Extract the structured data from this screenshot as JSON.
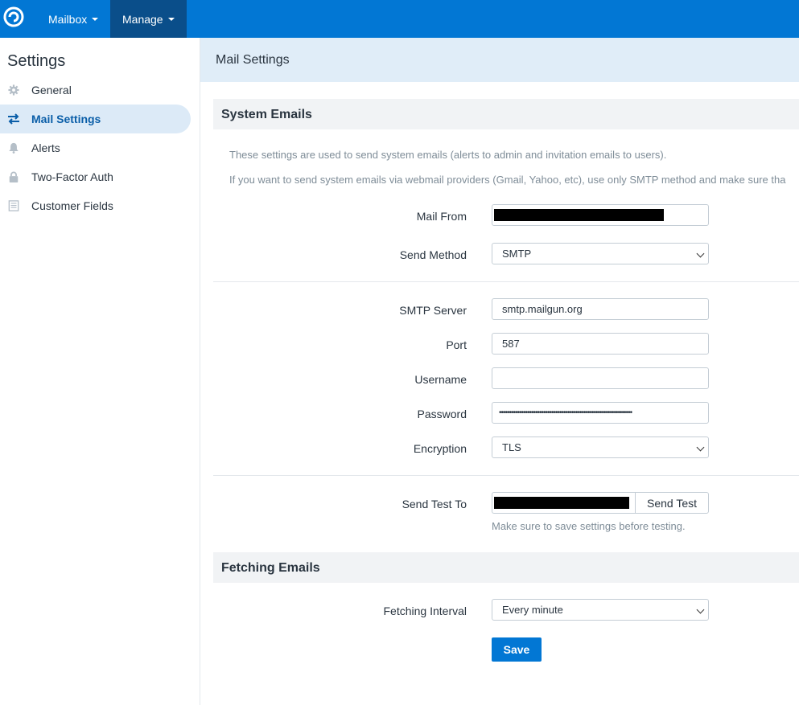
{
  "topbar": {
    "logo_icon": "freescout-logo-icon",
    "nav": [
      {
        "label": "Mailbox"
      },
      {
        "label": "Manage"
      }
    ]
  },
  "sidebar": {
    "title": "Settings",
    "items": [
      {
        "label": "General",
        "icon": "gear-icon"
      },
      {
        "label": "Mail Settings",
        "icon": "arrows-exchange-icon",
        "active": true
      },
      {
        "label": "Alerts",
        "icon": "bell-icon"
      },
      {
        "label": "Two-Factor Auth",
        "icon": "lock-icon"
      },
      {
        "label": "Customer Fields",
        "icon": "list-icon"
      }
    ]
  },
  "main": {
    "title": "Mail Settings",
    "system_emails": {
      "heading": "System Emails",
      "help1": "These settings are used to send system emails (alerts to admin and invitation emails to users).",
      "help2": "If you want to send system emails via webmail providers (Gmail, Yahoo, etc), use only SMTP method and make sure tha",
      "mail_from_label": "Mail From",
      "send_method_label": "Send Method",
      "send_method_value": "SMTP",
      "smtp_server_label": "SMTP Server",
      "smtp_server_value": "smtp.mailgun.org",
      "port_label": "Port",
      "port_value": "587",
      "username_label": "Username",
      "username_value": "",
      "password_label": "Password",
      "password_value": "••••••••••••••••••••••••••••••••••••••••••••••••••••••••••••••••••",
      "encryption_label": "Encryption",
      "encryption_value": "TLS",
      "send_test_label": "Send Test To",
      "send_test_button": "Send Test",
      "send_test_help": "Make sure to save settings before testing."
    },
    "fetching_emails": {
      "heading": "Fetching Emails",
      "interval_label": "Fetching Interval",
      "interval_value": "Every minute"
    },
    "save_label": "Save"
  },
  "colors": {
    "topbar": "#0277d4",
    "topbar_active": "#0a4e8a",
    "sidebar_active_bg": "#dceaf7",
    "accent_text": "#0a5ea8"
  }
}
